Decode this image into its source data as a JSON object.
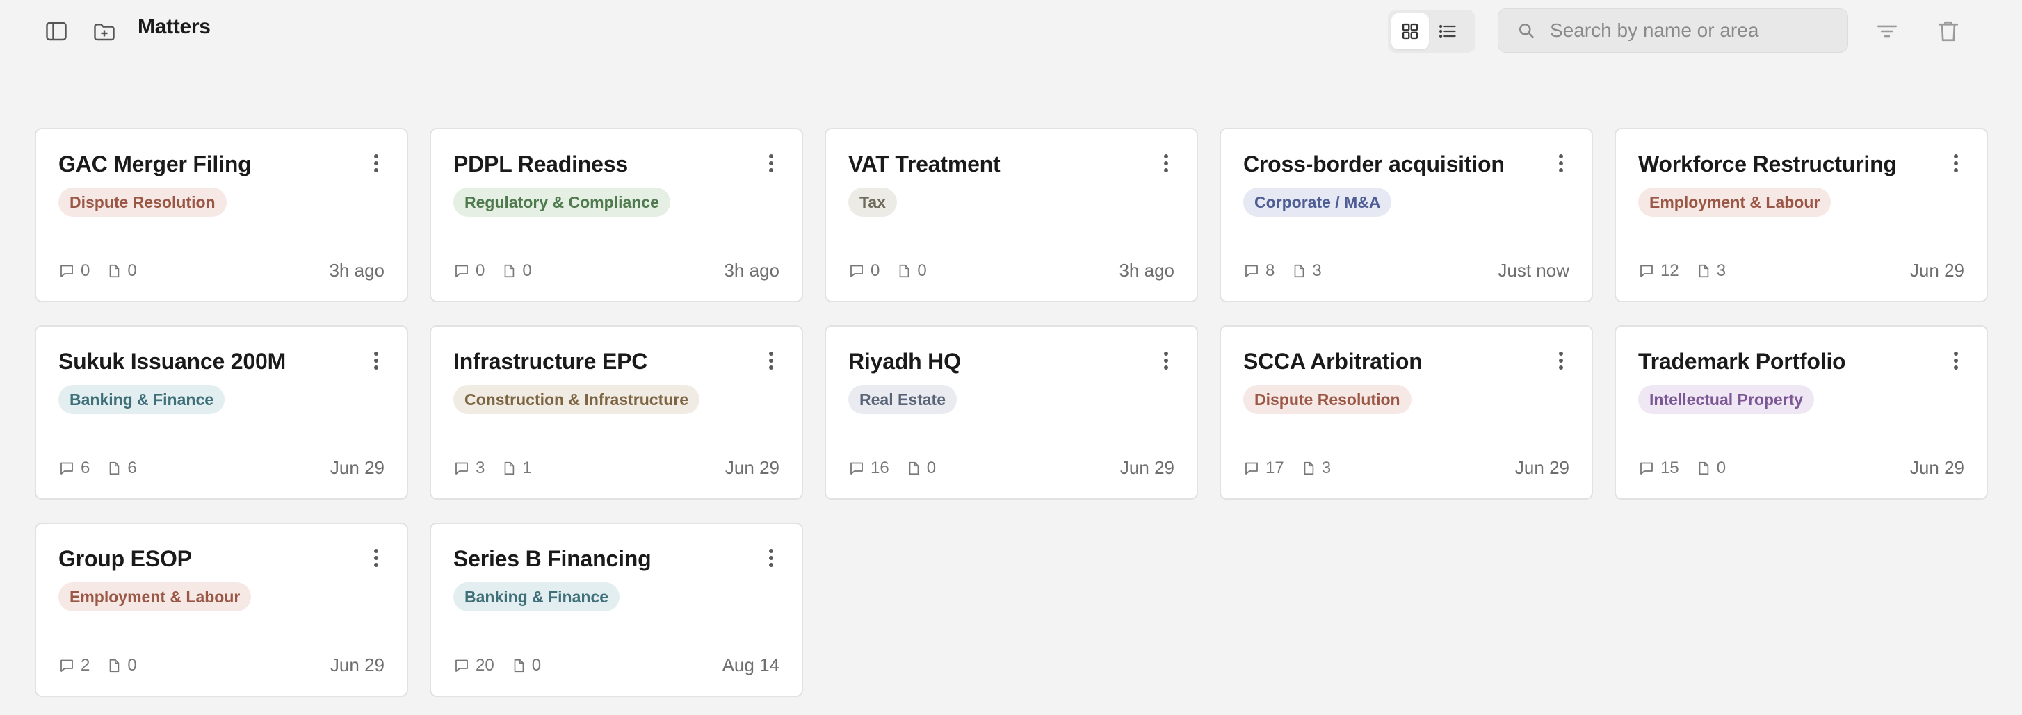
{
  "header": {
    "title": "Matters",
    "search_placeholder": "Search by name or area"
  },
  "icons": {
    "sidebar_toggle": "sidebar-panel-icon",
    "new_folder": "folder-plus-icon",
    "grid_view": "grid-icon",
    "list_view": "list-icon",
    "search": "search-icon",
    "filter": "filter-icon",
    "delete": "trash-icon",
    "comments": "comment-icon",
    "documents": "document-icon",
    "menu": "more-vertical-icon"
  },
  "view_mode": "grid",
  "matters": [
    {
      "title": "GAC Merger Filing",
      "area": "Dispute Resolution",
      "tag_bg": "#f6e8e5",
      "tag_fg": "#9b5746",
      "comments": "0",
      "docs": "0",
      "updated": "3h ago"
    },
    {
      "title": "PDPL Readiness",
      "area": "Regulatory & Compliance",
      "tag_bg": "#e5efe4",
      "tag_fg": "#4f7a4d",
      "comments": "0",
      "docs": "0",
      "updated": "3h ago"
    },
    {
      "title": "VAT Treatment",
      "area": "Tax",
      "tag_bg": "#ecebe6",
      "tag_fg": "#6e6a5c",
      "comments": "0",
      "docs": "0",
      "updated": "3h ago"
    },
    {
      "title": "Cross-border acquisition",
      "area": "Corporate / M&A",
      "tag_bg": "#e6e9f3",
      "tag_fg": "#4e5e95",
      "comments": "8",
      "docs": "3",
      "updated": "Just now"
    },
    {
      "title": "Workforce Restructuring",
      "area": "Employment & Labour",
      "tag_bg": "#f6e8e5",
      "tag_fg": "#9b5746",
      "comments": "12",
      "docs": "3",
      "updated": "Jun 29"
    },
    {
      "title": "Sukuk Issuance 200M",
      "area": "Banking & Finance",
      "tag_bg": "#e3eef0",
      "tag_fg": "#3f6f78",
      "comments": "6",
      "docs": "6",
      "updated": "Jun 29"
    },
    {
      "title": "Infrastructure EPC",
      "area": "Construction & Infrastructure",
      "tag_bg": "#f1ece3",
      "tag_fg": "#7d6543",
      "comments": "3",
      "docs": "1",
      "updated": "Jun 29"
    },
    {
      "title": "Riyadh HQ",
      "area": "Real Estate",
      "tag_bg": "#e9ebf0",
      "tag_fg": "#5a6477",
      "comments": "16",
      "docs": "0",
      "updated": "Jun 29"
    },
    {
      "title": "SCCA Arbitration",
      "area": "Dispute Resolution",
      "tag_bg": "#f6e8e5",
      "tag_fg": "#9b5746",
      "comments": "17",
      "docs": "3",
      "updated": "Jun 29"
    },
    {
      "title": "Trademark Portfolio",
      "area": "Intellectual Property",
      "tag_bg": "#efe7f3",
      "tag_fg": "#7c5795",
      "comments": "15",
      "docs": "0",
      "updated": "Jun 29"
    },
    {
      "title": "Group ESOP",
      "area": "Employment & Labour",
      "tag_bg": "#f6e8e5",
      "tag_fg": "#9b5746",
      "comments": "2",
      "docs": "0",
      "updated": "Jun 29"
    },
    {
      "title": "Series B Financing",
      "area": "Banking & Finance",
      "tag_bg": "#e3eef0",
      "tag_fg": "#3f6f78",
      "comments": "20",
      "docs": "0",
      "updated": "Aug 14"
    }
  ]
}
